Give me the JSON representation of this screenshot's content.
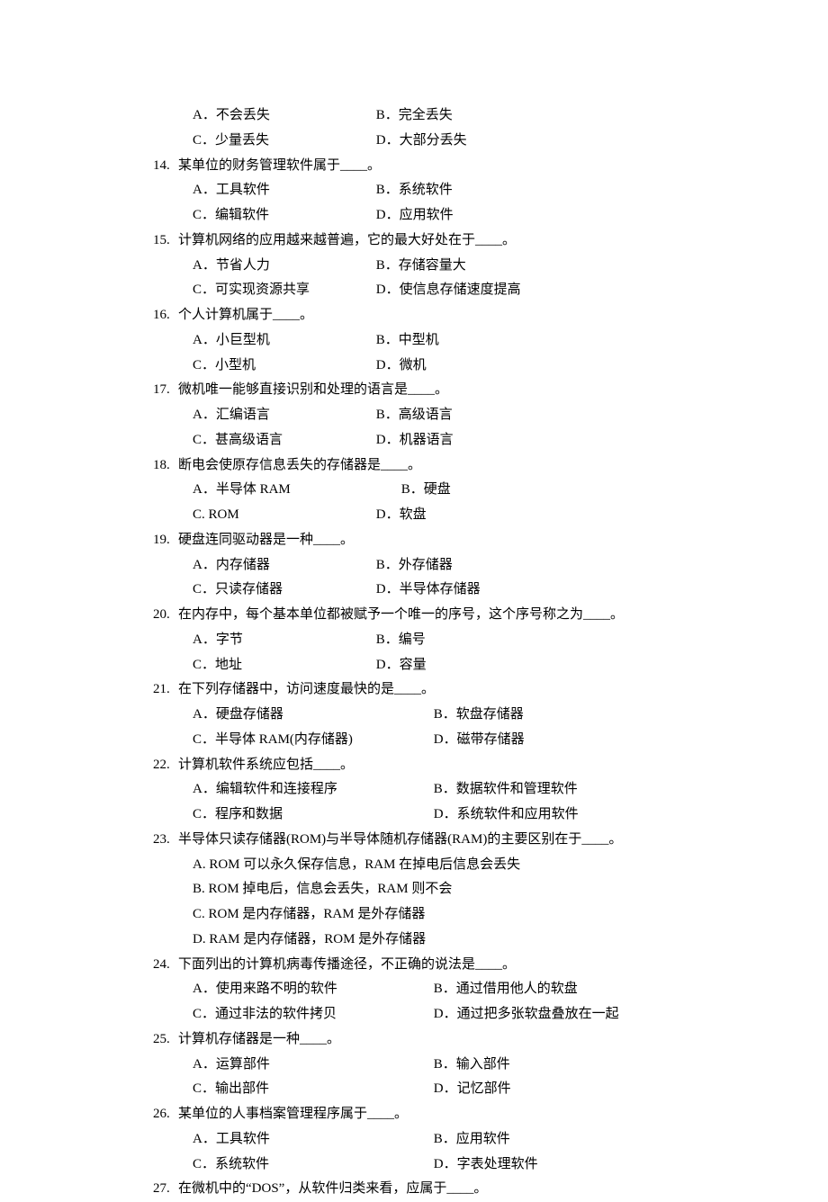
{
  "blank": "____",
  "period": "。",
  "q13": {
    "A": "A．不会丢失",
    "B": "B．完全丢失",
    "C": "C．少量丢失",
    "D": "D．大部分丢失"
  },
  "q14": {
    "num": "14.",
    "stem": "某单位的财务管理软件属于",
    "A": "A．工具软件",
    "B": "B．系统软件",
    "C": "C．编辑软件",
    "D": "D．应用软件"
  },
  "q15": {
    "num": "15.",
    "stem": "计算机网络的应用越来越普遍，它的最大好处在于",
    "A": "A．节省人力",
    "B": "B．存储容量大",
    "C": "C．可实现资源共享",
    "D": "D．使信息存储速度提高"
  },
  "q16": {
    "num": "16.",
    "stem": "个人计算机属于",
    "A": "A．小巨型机",
    "B": "B．中型机",
    "C": "C．小型机",
    "D": "D．微机"
  },
  "q17": {
    "num": "17.",
    "stem": "微机唯一能够直接识别和处理的语言是",
    "A": "A．汇编语言",
    "B": "B．高级语言",
    "C": "C．甚高级语言",
    "D": "D．机器语言"
  },
  "q18": {
    "num": "18.",
    "stem": "断电会使原存信息丢失的存储器是",
    "A": "A．半导体 RAM",
    "B": "B．硬盘",
    "C": "C. ROM",
    "D": "D．软盘"
  },
  "q19": {
    "num": "19.",
    "stem": "硬盘连同驱动器是一种",
    "A": "A．内存储器",
    "B": "B．外存储器",
    "C": "C．只读存储器",
    "D": "D．半导体存储器"
  },
  "q20": {
    "num": "20.",
    "stem": "在内存中，每个基本单位都被赋予一个唯一的序号，这个序号称之为",
    "A": "A．字节",
    "B": "B．编号",
    "C": "C．地址",
    "D": "D．容量"
  },
  "q21": {
    "num": "21.",
    "stem": "在下列存储器中，访问速度最快的是",
    "A": "A．硬盘存储器",
    "B": "B．软盘存储器",
    "C": "C．半导体 RAM(内存储器)",
    "D": "D．磁带存储器"
  },
  "q22": {
    "num": "22.",
    "stem": "计算机软件系统应包括",
    "A": "A．编辑软件和连接程序",
    "B": "B．数据软件和管理软件",
    "C": "C．程序和数据",
    "D": "D．系统软件和应用软件"
  },
  "q23": {
    "num": "23.",
    "stem": "半导体只读存储器(ROM)与半导体随机存储器(RAM)的主要区别在于",
    "A": "A. ROM 可以永久保存信息，RAM 在掉电后信息会丢失",
    "B": "B. ROM 掉电后，信息会丢失，RAM 则不会",
    "C": "C. ROM 是内存储器，RAM 是外存储器",
    "D": "D. RAM 是内存储器，ROM 是外存储器"
  },
  "q24": {
    "num": "24.",
    "stem": "下面列出的计算机病毒传播途径，不正确的说法是",
    "A": "A．使用来路不明的软件",
    "B": "B．通过借用他人的软盘",
    "C": "C．通过非法的软件拷贝",
    "D": "D．通过把多张软盘叠放在一起"
  },
  "q25": {
    "num": "25.",
    "stem": "计算机存储器是一种",
    "A": "A．运算部件",
    "B": "B．输入部件",
    "C": "C．输出部件",
    "D": "D．记忆部件"
  },
  "q26": {
    "num": "26.",
    "stem": "某单位的人事档案管理程序属于",
    "A": "A．工具软件",
    "B": "B．应用软件",
    "C": "C．系统软件",
    "D": "D．字表处理软件"
  },
  "q27": {
    "num": "27.",
    "stem": "在微机中的“DOS”，从软件归类来看，应属于"
  }
}
